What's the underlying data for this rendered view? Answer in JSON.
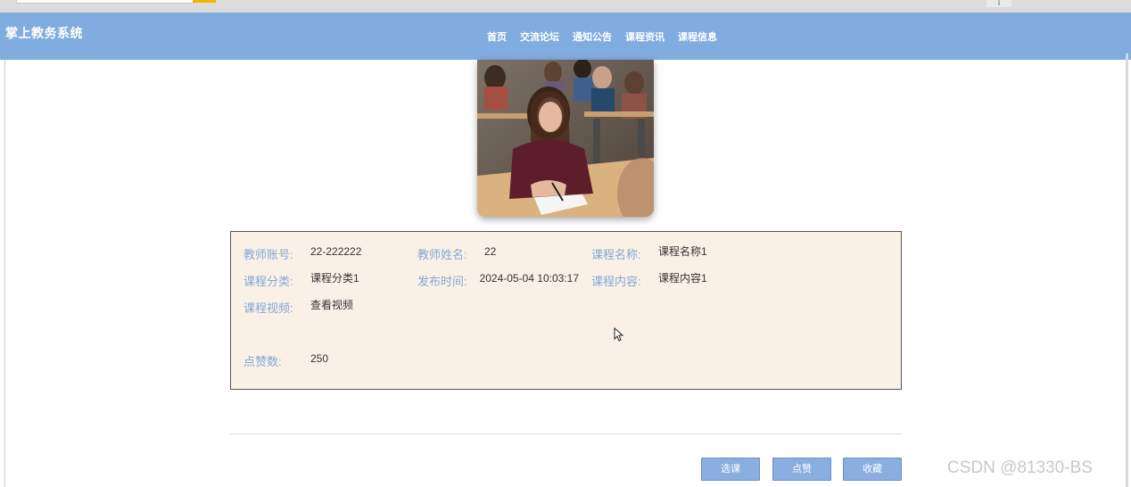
{
  "app": {
    "title": "掌上教务系统"
  },
  "nav": {
    "items": [
      "首页",
      "交流论坛",
      "通知公告",
      "课程资讯",
      "课程信息"
    ]
  },
  "course": {
    "image_name": "classroom-photo",
    "fields": {
      "teacher_account_label": "教师账号:",
      "teacher_account": "22-222222",
      "teacher_name_label": "教师姓名:",
      "teacher_name": "22",
      "course_name_label": "课程名称:",
      "course_name": "课程名称1",
      "course_category_label": "课程分类:",
      "course_category": "课程分类1",
      "publish_time_label": "发布时间:",
      "publish_time": "2024-05-04 10:03:17",
      "course_content_label": "课程内容:",
      "course_content": "课程内容1",
      "course_video_label": "课程视频:",
      "course_video": "查看视频",
      "likes_label": "点赞数:",
      "likes": "250"
    }
  },
  "actions": {
    "select": "选课",
    "like": "点赞",
    "favorite": "收藏"
  },
  "watermark": "CSDN @81330-BS",
  "colors": {
    "header": "#80acdf",
    "panel": "#faf1e6",
    "label": "#84a7d6",
    "button": "#8aaee0"
  }
}
